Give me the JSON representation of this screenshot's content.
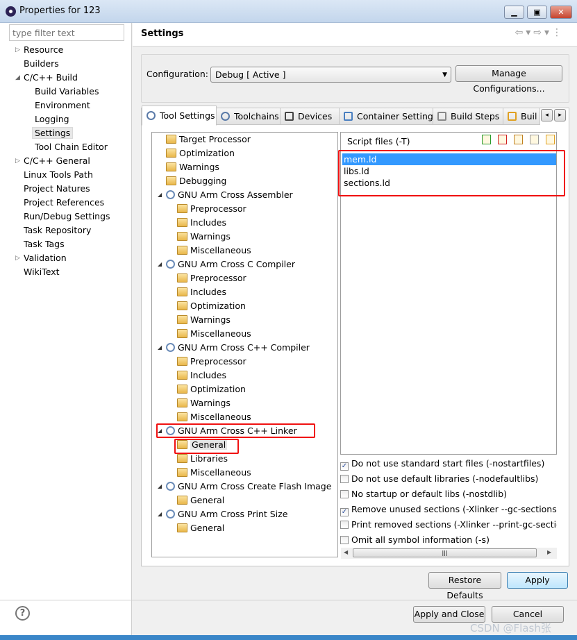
{
  "window": {
    "title": "Properties for 123",
    "controls": [
      "minimize",
      "maximize",
      "close"
    ]
  },
  "filter": {
    "placeholder": "type filter text"
  },
  "nav": [
    {
      "label": "Resource",
      "level": 0,
      "toggle": "collapsed"
    },
    {
      "label": "Builders",
      "level": 0
    },
    {
      "label": "C/C++ Build",
      "level": 0,
      "toggle": "expanded"
    },
    {
      "label": "Build Variables",
      "level": 1
    },
    {
      "label": "Environment",
      "level": 1
    },
    {
      "label": "Logging",
      "level": 1
    },
    {
      "label": "Settings",
      "level": 1,
      "selected": true
    },
    {
      "label": "Tool Chain Editor",
      "level": 1
    },
    {
      "label": "C/C++ General",
      "level": 0,
      "toggle": "collapsed"
    },
    {
      "label": "Linux Tools Path",
      "level": 0
    },
    {
      "label": "Project Natures",
      "level": 0
    },
    {
      "label": "Project References",
      "level": 0
    },
    {
      "label": "Run/Debug Settings",
      "level": 0
    },
    {
      "label": "Task Repository",
      "level": 0
    },
    {
      "label": "Task Tags",
      "level": 0
    },
    {
      "label": "Validation",
      "level": 0,
      "toggle": "collapsed"
    },
    {
      "label": "WikiText",
      "level": 0
    }
  ],
  "header": {
    "title": "Settings"
  },
  "config": {
    "label": "Configuration:",
    "value": "Debug  [ Active ]",
    "manage_label": "Manage Configurations..."
  },
  "tabs": [
    {
      "label": "Tool Settings",
      "active": true
    },
    {
      "label": "Toolchains"
    },
    {
      "label": "Devices"
    },
    {
      "label": "Container Settings"
    },
    {
      "label": "Build Steps"
    },
    {
      "label": "Buil"
    }
  ],
  "tool_tree": [
    {
      "label": "Target Processor",
      "level": 1,
      "icon": "folder-options"
    },
    {
      "label": "Optimization",
      "level": 1,
      "icon": "folder-options"
    },
    {
      "label": "Warnings",
      "level": 1,
      "icon": "folder-options"
    },
    {
      "label": "Debugging",
      "level": 1,
      "icon": "folder-options"
    },
    {
      "label": "GNU Arm Cross Assembler",
      "level": 1,
      "icon": "tool",
      "expanded": true
    },
    {
      "label": "Preprocessor",
      "level": 2,
      "icon": "folder-options"
    },
    {
      "label": "Includes",
      "level": 2,
      "icon": "folder-options"
    },
    {
      "label": "Warnings",
      "level": 2,
      "icon": "folder-options"
    },
    {
      "label": "Miscellaneous",
      "level": 2,
      "icon": "folder-options"
    },
    {
      "label": "GNU Arm Cross C Compiler",
      "level": 1,
      "icon": "tool",
      "expanded": true
    },
    {
      "label": "Preprocessor",
      "level": 2,
      "icon": "folder-options"
    },
    {
      "label": "Includes",
      "level": 2,
      "icon": "folder-options"
    },
    {
      "label": "Optimization",
      "level": 2,
      "icon": "folder-options"
    },
    {
      "label": "Warnings",
      "level": 2,
      "icon": "folder-options"
    },
    {
      "label": "Miscellaneous",
      "level": 2,
      "icon": "folder-options"
    },
    {
      "label": "GNU Arm Cross C++ Compiler",
      "level": 1,
      "icon": "tool",
      "expanded": true
    },
    {
      "label": "Preprocessor",
      "level": 2,
      "icon": "folder-options"
    },
    {
      "label": "Includes",
      "level": 2,
      "icon": "folder-options"
    },
    {
      "label": "Optimization",
      "level": 2,
      "icon": "folder-options"
    },
    {
      "label": "Warnings",
      "level": 2,
      "icon": "folder-options"
    },
    {
      "label": "Miscellaneous",
      "level": 2,
      "icon": "folder-options"
    },
    {
      "label": "GNU Arm Cross C++ Linker",
      "level": 1,
      "icon": "tool",
      "expanded": true,
      "highlighted": true
    },
    {
      "label": "General",
      "level": 2,
      "icon": "folder-options",
      "selected": true,
      "highlighted": true
    },
    {
      "label": "Libraries",
      "level": 2,
      "icon": "folder-options"
    },
    {
      "label": "Miscellaneous",
      "level": 2,
      "icon": "folder-options"
    },
    {
      "label": "GNU Arm Cross Create Flash Image",
      "level": 1,
      "icon": "tool",
      "expanded": true
    },
    {
      "label": "General",
      "level": 2,
      "icon": "folder-options"
    },
    {
      "label": "GNU Arm Cross Print Size",
      "level": 1,
      "icon": "tool",
      "expanded": true
    },
    {
      "label": "General",
      "level": 2,
      "icon": "folder-options"
    }
  ],
  "script_files": {
    "label": "Script files (-T)",
    "items": [
      "mem.ld",
      "libs.ld",
      "sections.ld"
    ],
    "selected_index": 0,
    "toolbar_icons": [
      "add-icon",
      "delete-icon",
      "edit-icon",
      "move-up-icon",
      "move-down-icon"
    ]
  },
  "options": [
    {
      "label": "Do not use standard start files (-nostartfiles)",
      "checked": true
    },
    {
      "label": "Do not use default libraries (-nodefaultlibs)",
      "checked": false
    },
    {
      "label": "No startup or default libs (-nostdlib)",
      "checked": false
    },
    {
      "label": "Remove unused sections (-Xlinker --gc-sections)",
      "checked": true
    },
    {
      "label": "Print removed sections (-Xlinker --print-gc-sections)",
      "checked": false
    },
    {
      "label": "Omit all symbol information (-s)",
      "checked": false
    }
  ],
  "buttons": {
    "restore_defaults": "Restore Defaults",
    "apply": "Apply",
    "apply_and_close": "Apply and Close",
    "cancel": "Cancel"
  },
  "watermark": "CSDN @Flash张",
  "colors": {
    "highlight_box": "#f01010",
    "selection": "#3399ff"
  }
}
